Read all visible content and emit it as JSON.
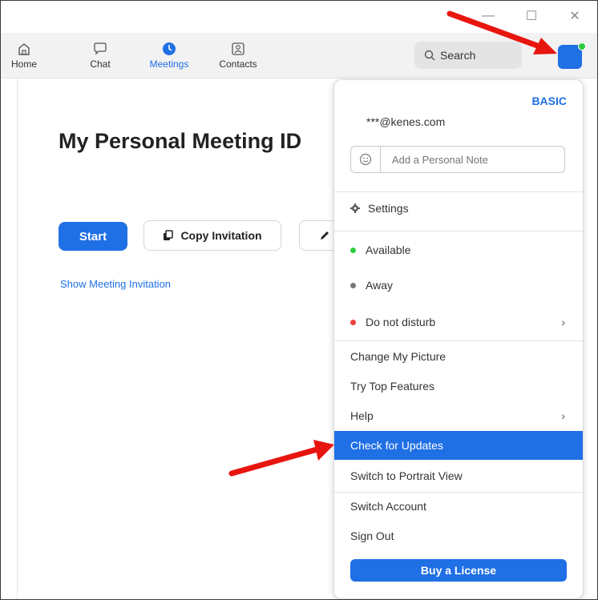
{
  "window": {
    "minimize": "—",
    "maximize": "☐",
    "close": "✕"
  },
  "nav": {
    "items": [
      {
        "label": "Home",
        "icon": "home-icon"
      },
      {
        "label": "Chat",
        "icon": "chat-icon"
      },
      {
        "label": "Meetings",
        "icon": "clock-icon",
        "active": true
      },
      {
        "label": "Contacts",
        "icon": "contacts-icon"
      }
    ],
    "search_label": "Search"
  },
  "main": {
    "title": "My Personal Meeting ID",
    "start_label": "Start",
    "copy_label": "Copy Invitation",
    "show_invitation": "Show Meeting Invitation"
  },
  "profile_menu": {
    "plan": "BASIC",
    "email": "***@kenes.com",
    "note_placeholder": "Add a Personal Note",
    "settings": "Settings",
    "status": [
      {
        "label": "Available",
        "color": "#2ecc40"
      },
      {
        "label": "Away",
        "color": "#777777"
      },
      {
        "label": "Do not disturb",
        "color": "#e8413c"
      }
    ],
    "items": [
      "Change My Picture",
      "Try Top Features",
      "Help",
      "Check for Updates",
      "Switch to Portrait View",
      "Switch Account",
      "Sign Out"
    ],
    "highlighted_item": "Check for Updates",
    "buy_license": "Buy a License"
  },
  "colors": {
    "accent": "#1f6fe5",
    "arrow": "#e8150f",
    "nav_bg": "#f2f2f2"
  }
}
